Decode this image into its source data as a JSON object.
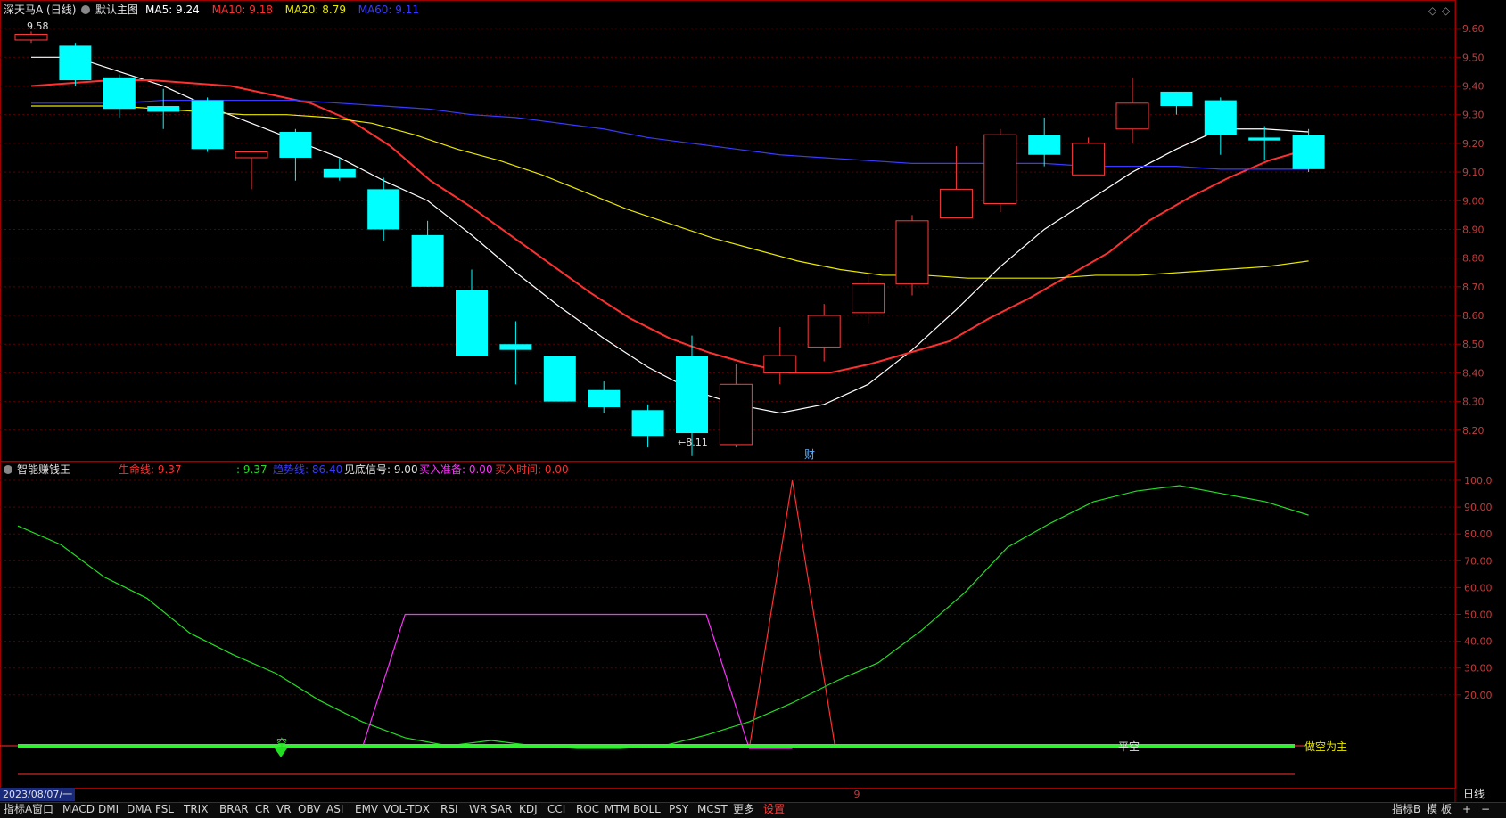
{
  "header": {
    "stock_name": "深天马A (日线)",
    "main_chart_label": "默认主图",
    "ma": [
      {
        "label": "MA5: 9.24",
        "color": "#ffffff"
      },
      {
        "label": "MA10: 9.18",
        "color": "#ff3030"
      },
      {
        "label": "MA20: 8.79",
        "color": "#e8e800"
      },
      {
        "label": "MA60: 9.11",
        "color": "#3a3aff"
      }
    ]
  },
  "price_axis": {
    "ticks": [
      "9.60",
      "9.50",
      "9.40",
      "9.30",
      "9.20",
      "9.10",
      "9.00",
      "8.90",
      "8.80",
      "8.70",
      "8.60",
      "8.50",
      "8.40",
      "8.30",
      "8.20"
    ]
  },
  "annotations": {
    "high_label": "9.58",
    "low_label": "←8.11",
    "finance_marker": "财",
    "date_label": "2023/08/07/一",
    "period_label": "日线",
    "month_marker": "9"
  },
  "indicator": {
    "name": "智能赚钱王",
    "fields": [
      {
        "label": "生命线: 9.37",
        "color": "#ff3030"
      },
      {
        "label": ": 9.37",
        "color": "#22dd22"
      },
      {
        "label": "趋势线: 86.40",
        "color": "#3a3aff"
      },
      {
        "label": "见底信号: 9.00",
        "color": "#e0e0e0"
      },
      {
        "label": "买入准备: 0.00",
        "color": "#ff30ff"
      },
      {
        "label": "买入时间: 0.00",
        "color": "#ff3030"
      }
    ],
    "axis_ticks": [
      "100.0",
      "90.00",
      "80.00",
      "70.00",
      "60.00",
      "50.00",
      "40.00",
      "30.00",
      "20.00"
    ],
    "signal_labels": {
      "empty": "空",
      "flat": "平空",
      "short": "做空为主"
    }
  },
  "chart_data": {
    "type": "candlestick",
    "candles": [
      {
        "o": 9.56,
        "c": 9.58,
        "h": 9.59,
        "l": 9.55
      },
      {
        "o": 9.54,
        "c": 9.42,
        "h": 9.55,
        "l": 9.4
      },
      {
        "o": 9.43,
        "c": 9.32,
        "h": 9.44,
        "l": 9.29
      },
      {
        "o": 9.33,
        "c": 9.31,
        "h": 9.39,
        "l": 9.25
      },
      {
        "o": 9.35,
        "c": 9.18,
        "h": 9.36,
        "l": 9.17
      },
      {
        "o": 9.15,
        "c": 9.17,
        "h": 9.17,
        "l": 9.04
      },
      {
        "o": 9.24,
        "c": 9.15,
        "h": 9.25,
        "l": 9.07
      },
      {
        "o": 9.11,
        "c": 9.08,
        "h": 9.15,
        "l": 9.07
      },
      {
        "o": 9.04,
        "c": 8.9,
        "h": 9.08,
        "l": 8.86
      },
      {
        "o": 8.88,
        "c": 8.7,
        "h": 8.93,
        "l": 8.7
      },
      {
        "o": 8.69,
        "c": 8.46,
        "h": 8.76,
        "l": 8.46
      },
      {
        "o": 8.5,
        "c": 8.48,
        "h": 8.58,
        "l": 8.36
      },
      {
        "o": 8.46,
        "c": 8.3,
        "h": 8.46,
        "l": 8.3
      },
      {
        "o": 8.34,
        "c": 8.28,
        "h": 8.37,
        "l": 8.26
      },
      {
        "o": 8.27,
        "c": 8.18,
        "h": 8.29,
        "l": 8.14
      },
      {
        "o": 8.46,
        "c": 8.19,
        "h": 8.53,
        "l": 8.11
      },
      {
        "o": 8.15,
        "c": 8.36,
        "h": 8.43,
        "l": 8.14
      },
      {
        "o": 8.4,
        "c": 8.46,
        "h": 8.56,
        "l": 8.36
      },
      {
        "o": 8.49,
        "c": 8.6,
        "h": 8.64,
        "l": 8.44
      },
      {
        "o": 8.61,
        "c": 8.71,
        "h": 8.75,
        "l": 8.57
      },
      {
        "o": 8.71,
        "c": 8.93,
        "h": 8.95,
        "l": 8.67
      },
      {
        "o": 8.94,
        "c": 9.04,
        "h": 9.19,
        "l": 8.94
      },
      {
        "o": 8.99,
        "c": 9.23,
        "h": 9.25,
        "l": 8.96
      },
      {
        "o": 9.23,
        "c": 9.16,
        "h": 9.29,
        "l": 9.12
      },
      {
        "o": 9.09,
        "c": 9.2,
        "h": 9.22,
        "l": 9.09
      },
      {
        "o": 9.25,
        "c": 9.34,
        "h": 9.43,
        "l": 9.2
      },
      {
        "o": 9.38,
        "c": 9.33,
        "h": 9.38,
        "l": 9.3
      },
      {
        "o": 9.35,
        "c": 9.23,
        "h": 9.36,
        "l": 9.16
      },
      {
        "o": 9.22,
        "c": 9.21,
        "h": 9.26,
        "l": 9.14
      },
      {
        "o": 9.23,
        "c": 9.11,
        "h": 9.25,
        "l": 9.1
      }
    ],
    "ma_series": [
      {
        "name": "MA5",
        "color": "#ffffff",
        "values": [
          9.5,
          9.5,
          9.45,
          9.4,
          9.33,
          9.27,
          9.21,
          9.15,
          9.07,
          9.0,
          8.88,
          8.75,
          8.63,
          8.52,
          8.42,
          8.34,
          8.29,
          8.26,
          8.29,
          8.36,
          8.48,
          8.62,
          8.77,
          8.9,
          9.0,
          9.1,
          9.18,
          9.25,
          9.25,
          9.24
        ]
      },
      {
        "name": "MA10",
        "color": "#ff3030",
        "values": [
          9.4,
          9.41,
          9.42,
          9.42,
          9.41,
          9.4,
          9.37,
          9.34,
          9.28,
          9.19,
          9.07,
          8.98,
          8.88,
          8.78,
          8.68,
          8.59,
          8.52,
          8.47,
          8.43,
          8.4,
          8.4,
          8.43,
          8.47,
          8.51,
          8.59,
          8.66,
          8.74,
          8.82,
          8.93,
          9.01,
          9.08,
          9.14,
          9.18
        ]
      },
      {
        "name": "MA20",
        "color": "#e8e800",
        "values": [
          9.33,
          9.33,
          9.33,
          9.32,
          9.31,
          9.3,
          9.3,
          9.29,
          9.27,
          9.23,
          9.18,
          9.14,
          9.09,
          9.03,
          8.97,
          8.92,
          8.87,
          8.83,
          8.79,
          8.76,
          8.74,
          8.74,
          8.73,
          8.73,
          8.73,
          8.74,
          8.74,
          8.75,
          8.76,
          8.77,
          8.79
        ]
      },
      {
        "name": "MA60",
        "color": "#3a3aff",
        "values": [
          9.34,
          9.34,
          9.34,
          9.35,
          9.35,
          9.35,
          9.35,
          9.34,
          9.33,
          9.32,
          9.3,
          9.29,
          9.27,
          9.25,
          9.22,
          9.2,
          9.18,
          9.16,
          9.15,
          9.14,
          9.13,
          9.13,
          9.13,
          9.13,
          9.12,
          9.12,
          9.12,
          9.11,
          9.11,
          9.11
        ]
      }
    ],
    "indicator_series": [
      {
        "name": "green",
        "color": "#22dd22",
        "values": [
          83,
          76,
          64,
          56,
          43,
          35,
          28,
          18,
          10,
          4,
          1,
          3,
          1,
          0,
          0,
          1,
          5,
          10,
          17,
          25,
          32,
          44,
          58,
          75,
          84,
          92,
          96,
          98,
          95,
          92,
          87
        ]
      },
      {
        "name": "magenta",
        "color": "#ff30ff",
        "values": [
          null,
          null,
          null,
          null,
          null,
          null,
          null,
          null,
          0,
          50,
          50,
          50,
          50,
          50,
          50,
          50,
          50,
          0,
          0
        ]
      },
      {
        "name": "red",
        "color": "#ff3030",
        "values": [
          null,
          null,
          null,
          null,
          null,
          null,
          null,
          null,
          null,
          null,
          null,
          null,
          null,
          null,
          null,
          null,
          null,
          0,
          100,
          0
        ]
      }
    ],
    "price_range": [
      8.1,
      9.65
    ],
    "indicator_range": [
      0,
      100
    ]
  }
}
